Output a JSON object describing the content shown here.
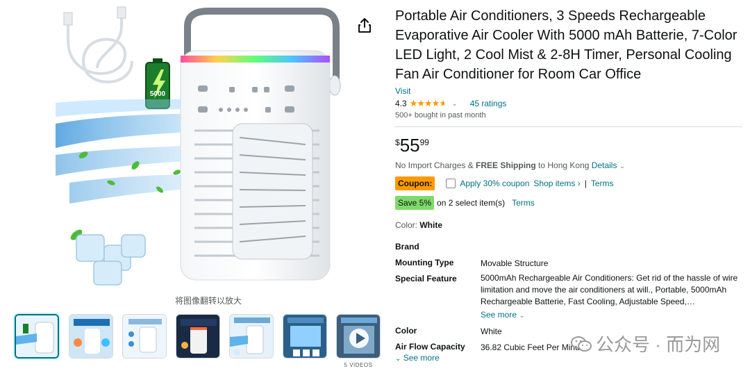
{
  "gallery": {
    "main_alt": "Portable air conditioner product image",
    "badge_text": "5000",
    "caption": "将图像翻转以放大",
    "videos_label": "5 VIDEOS",
    "thumbs": [
      {
        "name": "thumb-1"
      },
      {
        "name": "thumb-2"
      },
      {
        "name": "thumb-3"
      },
      {
        "name": "thumb-4"
      },
      {
        "name": "thumb-5"
      },
      {
        "name": "thumb-6"
      },
      {
        "name": "thumb-video"
      }
    ]
  },
  "product": {
    "title": "Portable Air Conditioners, 3 Speeds Rechargeable Evaporative Air Cooler With 5000 mAh Batterie, 7-Color LED Light, 2 Cool Mist & 2-8H Timer, Personal Cooling Fan Air Conditioner for Room Car Office",
    "store_link": "Visit",
    "rating": "4.3",
    "stars_fraction": 0.86,
    "ratings_count": "45 ratings",
    "bought": "500+ bought in past month",
    "price": {
      "currency": "$",
      "whole": "55",
      "fraction": "99"
    },
    "shipping": {
      "prefix": "No Import Charges & ",
      "bold": "FREE Shipping",
      "suffix": " to Hong Kong ",
      "details": "Details"
    },
    "coupon": {
      "badge": "Coupon:",
      "apply": "Apply 30% coupon",
      "shop": "Shop items ›",
      "sep": "|",
      "terms": "Terms"
    },
    "save": {
      "badge": "Save 5%",
      "text": "on 2 select item(s)",
      "terms": "Terms"
    },
    "color_label": "Color: ",
    "color_value": "White"
  },
  "specs": [
    {
      "key": "Brand",
      "value": ""
    },
    {
      "key": "Mounting Type",
      "value": "Movable Structure"
    },
    {
      "key": "Special Feature",
      "value": "5000mAh Rechargeable Air Conditioners: Get rid of the hassle of wire limitation and move the air conditioners at will., Portable, 5000mAh Rechargeable Batterie, Fast Cooling, Adjustable Speed,…"
    },
    {
      "key": "Color",
      "value": "White"
    },
    {
      "key": "Air Flow Capacity",
      "value": "36.82 Cubic Feet Per Minute"
    }
  ],
  "see_more_1": "See more",
  "see_more_2": "See more",
  "watermark": "公众号 · 而为网",
  "colors": {
    "link": "#007185",
    "coupon": "#ff9900",
    "save": "#7fda69",
    "star": "#ff9900"
  }
}
